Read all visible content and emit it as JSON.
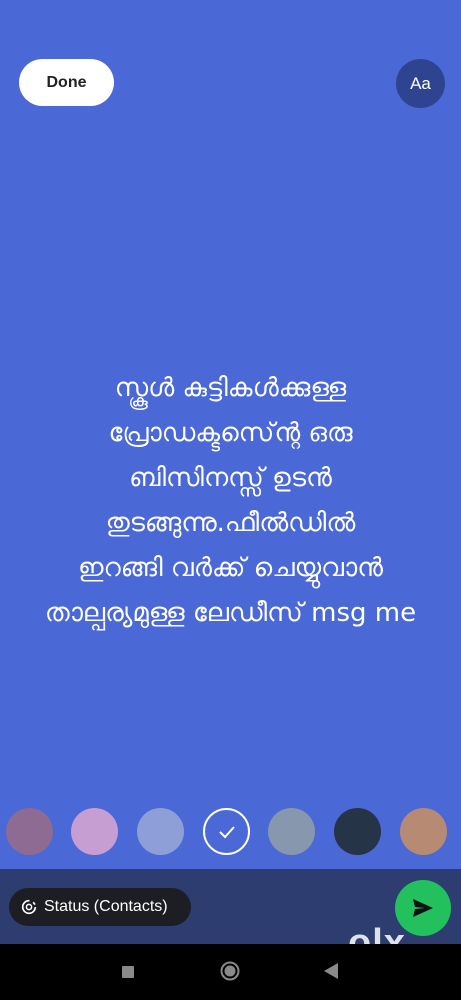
{
  "header": {
    "done_label": "Done",
    "font_button_label": "Aa"
  },
  "status": {
    "text": "സ്കൂൾ കുട്ടികൾക്കുള്ള\nപ്രോഡക്ടസ്ന്റെ ഒരു\nബിസിനസ്സ് ഉടൻ\nതുടങ്ങുന്നു.ഫീൽഡിൽ\nഇറങ്ങി വർക്ക് ചെയ്യുവാൻ\nതാല്പര്യമുള്ള ലേഡീസ് msg me",
    "background_color": "#4a68d6",
    "text_color": "#ffffff"
  },
  "palette": {
    "colors": [
      "#8d6b93",
      "#c79ed2",
      "#8e9ed6",
      "#4a68d6",
      "#8797ad",
      "#253447",
      "#b78b73"
    ],
    "selected_index": 3
  },
  "footer": {
    "audience_label": "Status (Contacts)",
    "send_color": "#22c15e"
  },
  "watermark": {
    "text": "olx"
  }
}
